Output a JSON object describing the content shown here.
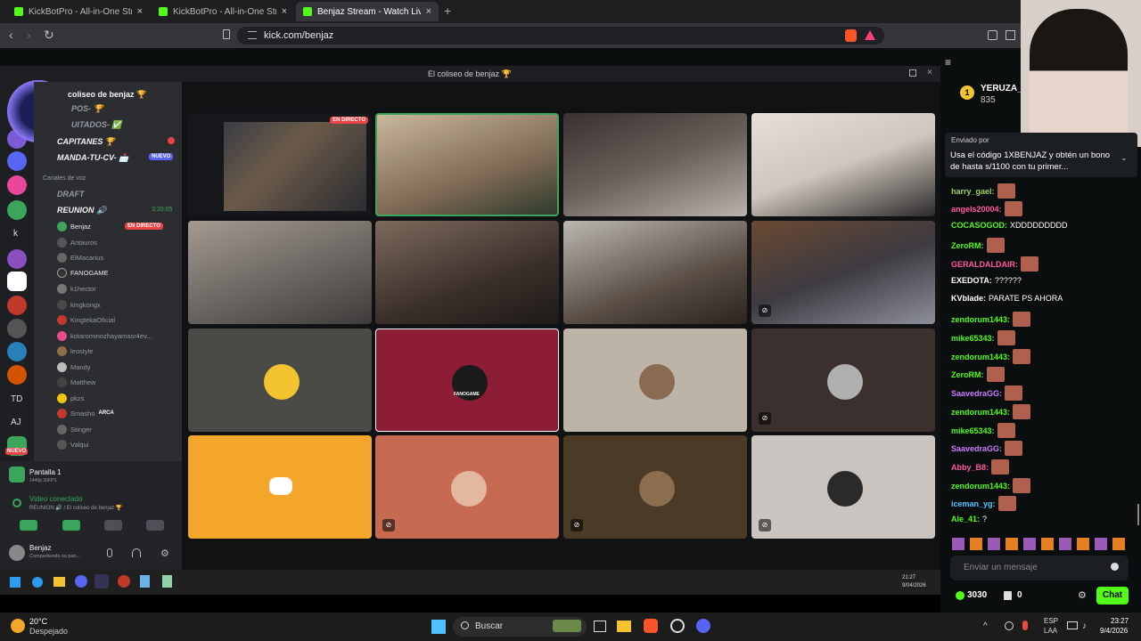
{
  "browser": {
    "tabs": [
      {
        "label": "KickBotPro - All-in-One Streaming To",
        "icon_color": "#53fc18"
      },
      {
        "label": "KickBotPro - All-in-One Streaming To",
        "icon_color": "#53fc18"
      },
      {
        "label": "Benjaz Stream - Watch Live o",
        "icon_color": "#53fc18"
      }
    ],
    "tab_close": "×",
    "new_tab": "+",
    "url": "kick.com/benjaz",
    "back": "‹",
    "forward": "›",
    "reload": "↻"
  },
  "discord": {
    "window_title": "El coliseo de benjaz 🏆",
    "server_name": "coliseo de benjaz 🏆",
    "channels": [
      {
        "label": "POS- 🏆"
      },
      {
        "label": "UITADOS- ✅"
      },
      {
        "label": "CAPITANES 🏆"
      },
      {
        "label": "MANDA-TU-CV- 📩",
        "badge": "NUEVO"
      }
    ],
    "voice_section": "Canales de voz",
    "draft": "DRAFT",
    "voice_channel": "REUNION 🔊",
    "voice_timer": "3:20:05",
    "voice_users": [
      "Benjaz",
      "Antauros",
      "ElMacarius",
      "FANOGAME",
      "k1hector",
      "kingkongx",
      "KingtekaOficial",
      "kotarominozhayamasr4ev...",
      "leostyle",
      "Mandy",
      "Matthew",
      "pkzs",
      "Smasho",
      "Stinger",
      "Valqui"
    ],
    "live_badge": "EN DIRECTO",
    "smasho_tag": "ARCA",
    "rail_labels": [
      "k",
      "TD",
      "AJ"
    ],
    "nuevo_rail": "NUEVO",
    "stream": {
      "title": "Pantalla 1",
      "sub": "1440p 30FPS"
    },
    "video": {
      "status": "Video conectado",
      "where": "REUNION 🔊 / El coliseo de benjaz 🏆"
    },
    "user": {
      "name": "Benjaz",
      "status": "Compartiendo su pan..."
    },
    "tile_live": "EN DIRECTO",
    "tile_fanogame": "FANOGAME"
  },
  "kick": {
    "user": "YERUZA_M",
    "points": "835",
    "pinned_by": "Enviado por",
    "pinned_text": "Usa el código 1XBENJAZ y obtén un bono de hasta s/1100 con tu primer...",
    "messages": [
      {
        "user": "harry_gael:",
        "color": "#9ccf5f",
        "text": "",
        "emote": true
      },
      {
        "user": "angels20004:",
        "color": "#ff5a9e",
        "text": "",
        "emote": true
      },
      {
        "user": "COCASOGOD:",
        "color": "#53fc18",
        "text": "XDDDDDDDDD",
        "emote": false
      },
      {
        "user": "ZeroRM:",
        "color": "#53fc18",
        "text": "",
        "emote": true
      },
      {
        "user": "GERALDALDAIR:",
        "color": "#ff5a9e",
        "text": "",
        "emote": true
      },
      {
        "user": "EXEDOTA:",
        "color": "#ffffff",
        "text": "??????",
        "emote": false
      },
      {
        "user": "KVblade:",
        "color": "#ffffff",
        "text": "PARATE PS AHORA",
        "emote": false
      },
      {
        "user": "zendorum1443:",
        "color": "#53fc18",
        "text": "",
        "emote": true
      },
      {
        "user": "mike65343:",
        "color": "#53fc18",
        "text": "",
        "emote": true
      },
      {
        "user": "zendorum1443:",
        "color": "#53fc18",
        "text": "",
        "emote": true
      },
      {
        "user": "ZeroRM:",
        "color": "#53fc18",
        "text": "",
        "emote": true
      },
      {
        "user": "SaavedraGG:",
        "color": "#c77dff",
        "text": "",
        "emote": true
      },
      {
        "user": "zendorum1443:",
        "color": "#53fc18",
        "text": "",
        "emote": true
      },
      {
        "user": "mike65343:",
        "color": "#53fc18",
        "text": "",
        "emote": true
      },
      {
        "user": "SaavedraGG:",
        "color": "#c77dff",
        "text": "",
        "emote": true
      },
      {
        "user": "Abby_B8:",
        "color": "#ff5a9e",
        "text": "",
        "emote": true
      },
      {
        "user": "zendorum1443:",
        "color": "#53fc18",
        "text": "",
        "emote": true
      },
      {
        "user": "iceman_yg:",
        "color": "#53c8ff",
        "text": "",
        "emote": true
      },
      {
        "user": "Ale_41:",
        "color": "#53fc18",
        "text": "?",
        "emote": false
      }
    ],
    "input_placeholder": "Enviar un mensaje",
    "points_bottom": "3030",
    "zero": "0",
    "chat_btn": "Chat"
  },
  "inner_taskbar": {
    "time": "21:27",
    "date": "9/04/2026"
  },
  "taskbar": {
    "weather_temp": "20°C",
    "weather_desc": "Despejado",
    "search": "Buscar",
    "lang1": "ESP",
    "lang2": "LAA",
    "time": "23:27",
    "date": "9/4/2026"
  }
}
